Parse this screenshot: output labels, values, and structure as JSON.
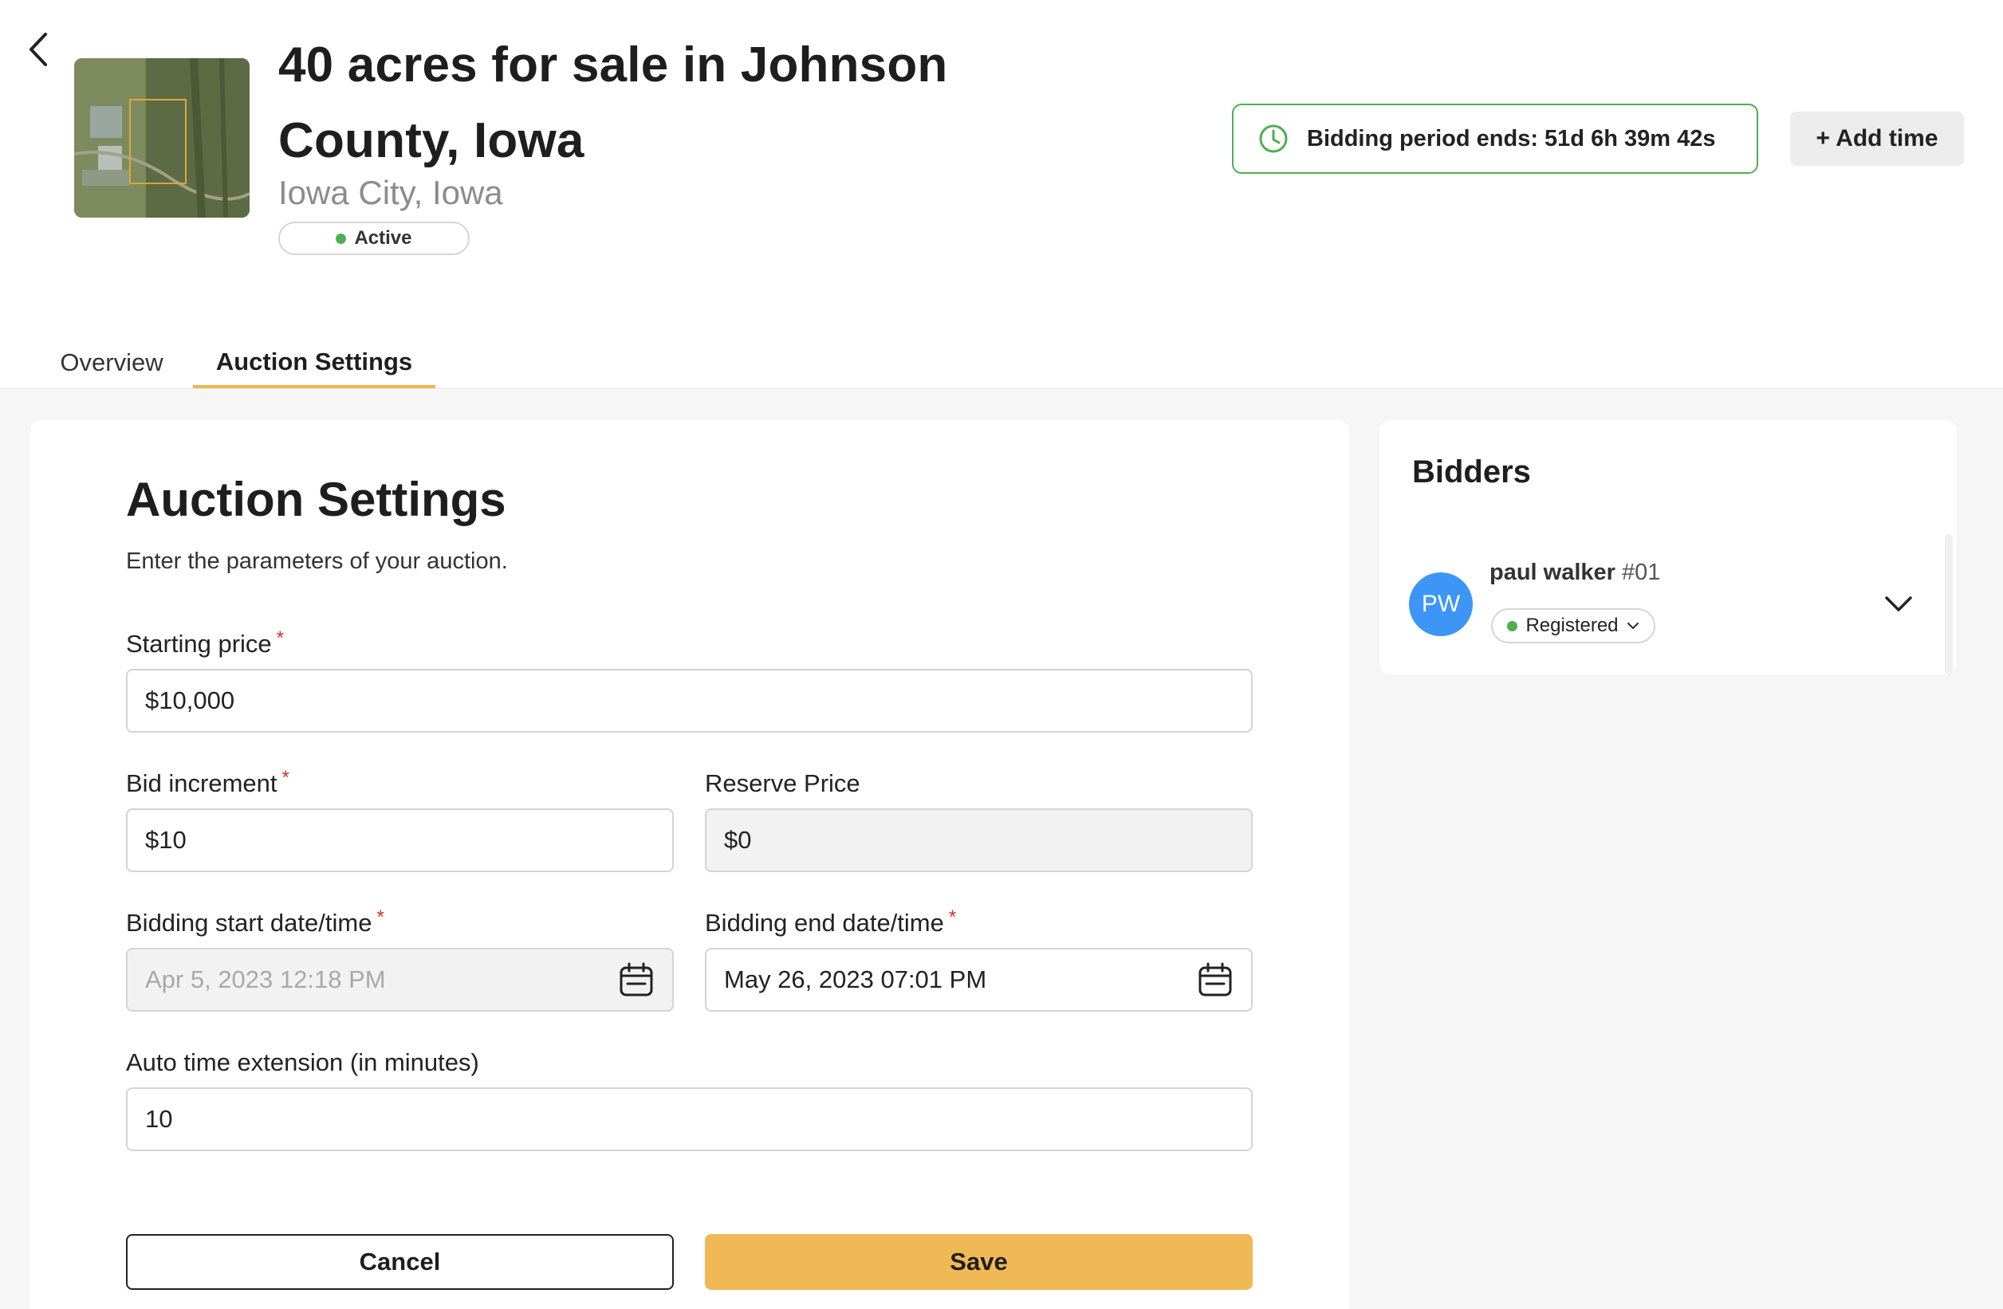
{
  "header": {
    "title": "40 acres for sale in Johnson County, Iowa",
    "location": "Iowa City, Iowa",
    "status": "Active",
    "timer_text": "Bidding period ends: 51d 6h 39m 42s",
    "add_time_label": "+ Add time"
  },
  "tabs": [
    {
      "label": "Overview",
      "active": false
    },
    {
      "label": "Auction Settings",
      "active": true
    }
  ],
  "form": {
    "heading": "Auction Settings",
    "description": "Enter the parameters of your auction.",
    "starting_price": {
      "label": "Starting price",
      "required_mark": "*",
      "value": "$10,000"
    },
    "bid_increment": {
      "label": "Bid increment",
      "required_mark": "*",
      "value": "$10"
    },
    "reserve_price": {
      "label": "Reserve Price",
      "value": "$0"
    },
    "start_datetime": {
      "label": "Bidding start date/time",
      "required_mark": "*",
      "value": "Apr 5, 2023 12:18 PM"
    },
    "end_datetime": {
      "label": "Bidding end date/time",
      "required_mark": "*",
      "value": "May 26, 2023 07:01 PM"
    },
    "auto_extension": {
      "label": "Auto time extension (in minutes)",
      "value": "10"
    },
    "cancel_label": "Cancel",
    "save_label": "Save"
  },
  "bidders": {
    "title": "Bidders",
    "items": [
      {
        "initials": "PW",
        "name": "paul walker",
        "number": "#01",
        "status": "Registered"
      }
    ]
  },
  "colors": {
    "accent": "#f0b955",
    "tab_underline": "#f0b54c",
    "active_green": "#4caf50",
    "avatar_blue": "#3d96f5",
    "required_red": "#d32f2f"
  },
  "icons": [
    "back-arrow-icon",
    "clock-icon",
    "calendar-icon",
    "chevron-down-icon"
  ]
}
